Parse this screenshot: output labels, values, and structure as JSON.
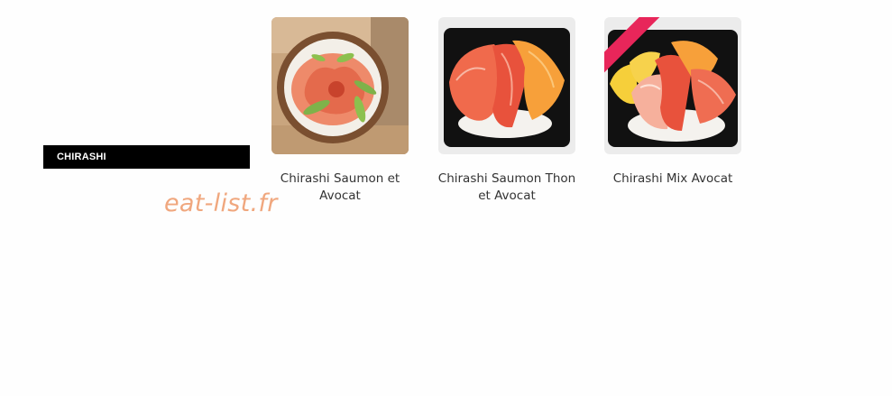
{
  "category": {
    "label": "CHIRASHI"
  },
  "watermark": {
    "text": "eat-list.fr"
  },
  "products": [
    {
      "name": "Chirashi Saumon et Avocat"
    },
    {
      "name": "Chirashi Saumon Thon et Avocat"
    },
    {
      "name": "Chirashi Mix Avocat",
      "ribbon": ""
    }
  ],
  "colors": {
    "badge_bg": "#000000",
    "watermark": "#f0a77e",
    "ribbon": "#e8265a",
    "text": "#333333"
  }
}
